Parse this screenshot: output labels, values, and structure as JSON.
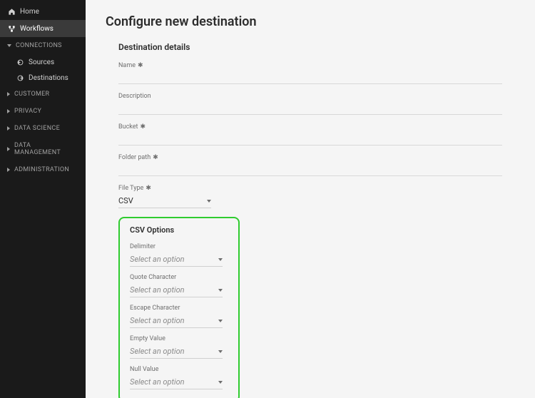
{
  "sidebar": {
    "home": "Home",
    "workflows": "Workflows",
    "sections": {
      "connections": "CONNECTIONS",
      "customer": "CUSTOMER",
      "privacy": "PRIVACY",
      "data_science": "DATA SCIENCE",
      "data_management": "DATA MANAGEMENT",
      "administration": "ADMINISTRATION"
    },
    "sources": "Sources",
    "destinations": "Destinations"
  },
  "page": {
    "title": "Configure new destination"
  },
  "details": {
    "heading": "Destination details",
    "name_label": "Name",
    "description_label": "Description",
    "bucket_label": "Bucket",
    "folder_label": "Folder path",
    "filetype_label": "File Type",
    "filetype_value": "CSV"
  },
  "csv": {
    "heading": "CSV Options",
    "placeholder": "Select an option",
    "delimiter_label": "Delimiter",
    "quote_label": "Quote Character",
    "escape_label": "Escape Character",
    "empty_label": "Empty Value",
    "null_label": "Null Value"
  }
}
